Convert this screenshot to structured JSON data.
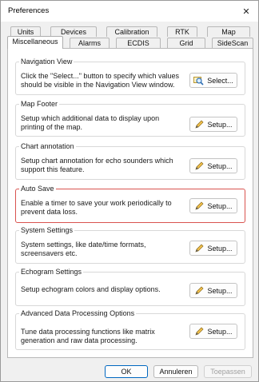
{
  "window": {
    "title": "Preferences",
    "close_glyph": "✕"
  },
  "tabs": {
    "row1": [
      "Units",
      "Devices",
      "Calibration",
      "RTK",
      "Map"
    ],
    "row2": [
      "Miscellaneous",
      "Alarms",
      "ECDIS",
      "Grid",
      "SideScan"
    ],
    "selected": "Miscellaneous"
  },
  "groups": [
    {
      "title": "Navigation View",
      "description": "Click the \"Select...\" button to specify which values should be visible in the Navigation View window.",
      "button": "Select...",
      "icon": "magnifier-icon"
    },
    {
      "title": "Map Footer",
      "description": "Setup which additional data to display upon printing of the map.",
      "button": "Setup...",
      "icon": "pencil-icon"
    },
    {
      "title": "Chart annotation",
      "description": "Setup chart annotation for echo sounders which support this feature.",
      "button": "Setup...",
      "icon": "pencil-icon"
    },
    {
      "title": "Auto Save",
      "description": "Enable a timer to save your work periodically to prevent data loss.",
      "button": "Setup...",
      "icon": "pencil-icon",
      "highlight_color": "#d9534f"
    },
    {
      "title": "System Settings",
      "description": "System settings, like date/time formats, screensavers etc.",
      "button": "Setup...",
      "icon": "pencil-icon"
    },
    {
      "title": "Echogram Settings",
      "description": "Setup echogram colors and display options.",
      "button": "Setup...",
      "icon": "pencil-icon"
    },
    {
      "title": "Advanced Data Processing Options",
      "description": "Tune data processing functions like matrix generation and raw data processing.",
      "button": "Setup...",
      "icon": "pencil-icon"
    }
  ],
  "footer": {
    "ok": "OK",
    "cancel": "Annuleren",
    "apply": "Toepassen",
    "apply_disabled": true
  },
  "colors": {
    "accent": "#0067c0",
    "highlight": "#d9534f"
  }
}
